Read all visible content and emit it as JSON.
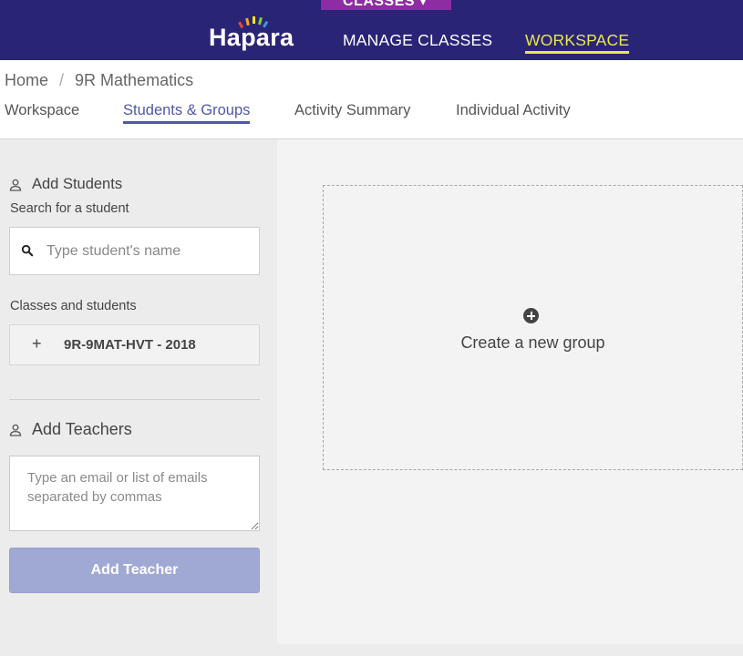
{
  "header": {
    "classes_tab_label": "CLASSES ▾",
    "logo_text": "Hapara",
    "nav": {
      "manage_classes": "MANAGE CLASSES",
      "workspace": "WORKSPACE"
    },
    "colors": {
      "bar": "#2a2477",
      "classes_tab": "#8d2ca3",
      "active_nav": "#e8e84a"
    }
  },
  "breadcrumb": {
    "home": "Home",
    "separator": "/",
    "current": "9R Mathematics"
  },
  "tabs": [
    {
      "label": "Workspace",
      "active": false
    },
    {
      "label": "Students & Groups",
      "active": true
    },
    {
      "label": "Activity Summary",
      "active": false
    },
    {
      "label": "Individual Activity",
      "active": false
    }
  ],
  "sidebar": {
    "add_students": {
      "title": "Add Students",
      "icon": "person-icon",
      "search_label": "Search for a student",
      "search_placeholder": "Type student's name",
      "search_value": "",
      "classes_label": "Classes and students",
      "classes": [
        {
          "expand_symbol": "+",
          "label": "9R-9MAT-HVT - 2018"
        }
      ]
    },
    "add_teachers": {
      "title": "Add Teachers",
      "icon": "person-icon",
      "email_placeholder": "Type an email or list of emails separated by commas",
      "email_value": "",
      "button_label": "Add Teacher",
      "button_color": "#9fa9d3"
    }
  },
  "main": {
    "create_group_label": "Create a new group",
    "create_group_icon": "plus-circle-icon"
  }
}
